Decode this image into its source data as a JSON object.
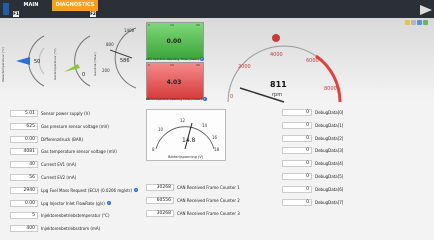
{
  "header": {
    "tab_main": "MAIN",
    "tab_diag": "DIAGNOSTICS",
    "tab_main_num": "F1",
    "tab_diag_num": "F2"
  },
  "gauges": [
    {
      "label": "Watertemperatuur (°C)",
      "value": "50"
    },
    {
      "label": "Gastemperatuur (°C)",
      "value": "0"
    },
    {
      "label": "Gasdruk (mbar)",
      "value": "586"
    }
  ],
  "indicators": {
    "lpg": {
      "value": "0.00",
      "caption": "LPG Injectors Opening Time (msec)"
    },
    "petrol": {
      "value": "4.03",
      "caption": "Petrol Injectors Opening Time (msec)"
    }
  },
  "rpm": {
    "value": "811",
    "unit": "rpm",
    "ticks": [
      "0",
      "2000",
      "4000",
      "6000",
      "8000"
    ]
  },
  "baro": {
    "value": "14.8",
    "caption": "Batterijspanning (V)",
    "ticks": [
      "8",
      "10",
      "12",
      "14",
      "16",
      "18"
    ]
  },
  "left_rows": [
    {
      "value": "5.01",
      "label": "Sensor power supply (V)"
    },
    {
      "value": "625",
      "label": "Gas pressure sensor voltage (mV)"
    },
    {
      "value": "0.00",
      "label": "Differenzdruck (BAR)"
    },
    {
      "value": "4081",
      "label": "Gas temperature sensor voltage (mV)"
    },
    {
      "value": "40",
      "label": "Current EV1 (mA)"
    },
    {
      "value": "56",
      "label": "Current EV2 (mA)"
    },
    {
      "value": "2940",
      "label": "Lpg Fuel Mass Request (ECU) (0.0206 mg/str)"
    },
    {
      "value": "0.00",
      "label": "Lpg Injector Inlet FlowRate (g/s)"
    },
    {
      "value": "5",
      "label": "Injektorenbetriebstemperatur (°C)"
    },
    {
      "value": "400",
      "label": "Injektorenbetriebsstrom (mA)"
    }
  ],
  "can_rows": [
    {
      "value": "30268",
      "label": "CAN Received Frame Counter 1"
    },
    {
      "value": "60556",
      "label": "CAN Received Frame Counter 2"
    },
    {
      "value": "30268",
      "label": "CAN Received Frame Counter 3"
    }
  ],
  "debug_rows": [
    {
      "value": "0",
      "label": "DebugData[0]"
    },
    {
      "value": "0",
      "label": "DebugData[1]"
    },
    {
      "value": "0",
      "label": "DebugData[2]"
    },
    {
      "value": "0",
      "label": "DebugData[3]"
    },
    {
      "value": "0",
      "label": "DebugData[4]"
    },
    {
      "value": "0",
      "label": "DebugData[5]"
    },
    {
      "value": "0",
      "label": "DebugData[6]"
    },
    {
      "value": "0",
      "label": "DebugData[7]"
    }
  ],
  "colors": {
    "accent": "#f5a020",
    "header": "#2b2f38",
    "help": "#2b6fd6"
  },
  "icon_names": [
    "save-icon",
    "print-icon",
    "settings-icon",
    "info-icon",
    "close-icon"
  ]
}
